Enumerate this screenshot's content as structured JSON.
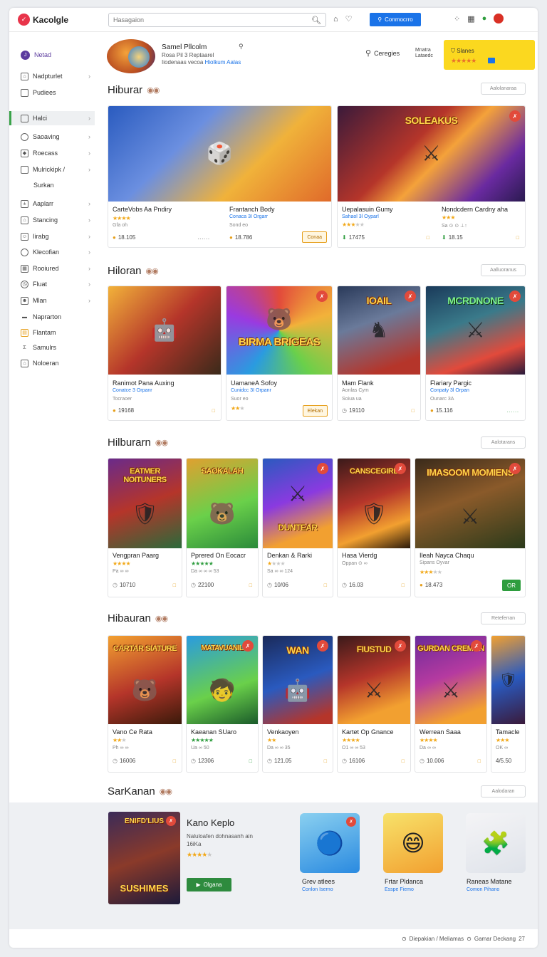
{
  "header": {
    "logo_text": "Kacolgle",
    "search_placeholder": "Hasagaion",
    "connect_label": "Conmocrro"
  },
  "sidebar": {
    "items": [
      {
        "label": "Netad",
        "icon": "J",
        "chevron": false
      },
      {
        "label": "Nadpturlet",
        "icon": "",
        "chevron": true
      },
      {
        "label": "Pudiees",
        "icon": "",
        "chevron": false
      },
      {
        "label": "Halci",
        "icon": "",
        "chevron": true
      },
      {
        "label": "Saoaving",
        "icon": "",
        "chevron": true
      },
      {
        "label": "Roecass",
        "icon": "",
        "chevron": true
      },
      {
        "label": "Mulrickipk /",
        "icon": "",
        "chevron": true
      },
      {
        "label": "Surkan",
        "icon": "",
        "chevron": false
      },
      {
        "label": "Aaplarr",
        "icon": "",
        "chevron": true
      },
      {
        "label": "Stancing",
        "icon": "",
        "chevron": true
      },
      {
        "label": "Iirabg",
        "icon": "",
        "chevron": true
      },
      {
        "label": "Klecofian",
        "icon": "",
        "chevron": true
      },
      {
        "label": "Rooiured",
        "icon": "",
        "chevron": true
      },
      {
        "label": "Fluat",
        "icon": "",
        "chevron": true
      },
      {
        "label": "Mlan",
        "icon": "",
        "chevron": true
      },
      {
        "label": "Naprarton",
        "icon": "",
        "chevron": false
      },
      {
        "label": "Flantam",
        "icon": "",
        "chevron": false
      },
      {
        "label": "Samulrs",
        "icon": "",
        "chevron": false
      },
      {
        "label": "Noloeran",
        "icon": "",
        "chevron": false
      }
    ]
  },
  "profile": {
    "name": "Samel Pllcolm",
    "line1": "Rosa Pil 3 Reptaarel",
    "line2": "Iiodenaas vecoa",
    "line2_link": "Hiolkum Aalas",
    "categories_label": "Ceregies",
    "small_link": "Mnatra Lataedc",
    "rating_label": "Slanes",
    "rating_stars": "★★★★★"
  },
  "sections": [
    {
      "title": "Hiburar",
      "see_more": "Aalolanaraa",
      "cards": [
        {
          "art_title": "",
          "title": "CarteVobs Aa Pndiry",
          "sub": "",
          "stars": "★★★★",
          "dim": "",
          "meta": "Gfa oh",
          "count": "18.105",
          "right": "......"
        },
        {
          "title": "Frantanch Body",
          "sub": "Conaca 3I Orgarr",
          "stars": "",
          "meta": "Sond eo",
          "count": "18.786",
          "button": "Conaa"
        },
        {
          "art_title": "SOLEAKUS",
          "title": "Uepalasuin Gumy",
          "sub": "Sahaol 3l Oyparl",
          "stars": "★★★",
          "dim": "★★",
          "meta": "",
          "count": "17475",
          "right": "□"
        },
        {
          "title": "Nondcdern Cardny aha",
          "sub": "",
          "stars": "★★★",
          "dim": "",
          "meta": "Sa ⊙ ⊙ ⊥↑",
          "count": "18.15",
          "right": "□"
        }
      ]
    },
    {
      "title": "Hiloran",
      "see_more": "Aalluoranus",
      "cards": [
        {
          "title": "Ranimot Pana Auxing",
          "sub": "Conatce 3 Orpanr",
          "stars": "",
          "meta": "Tocraoer",
          "count": "19168",
          "right": "□"
        },
        {
          "art_title": "BIRMA BRIGEAS",
          "title": "UamaneA Sofoy",
          "sub": "Cunidcc 3I Orpanr",
          "stars": "★★",
          "dim": "★",
          "meta": "Suor eo",
          "count": "",
          "button": "Elekan"
        },
        {
          "art_title": "IOAIL",
          "title": "Mam Flank",
          "sub": "Aonlas Cym",
          "stars": "",
          "meta": "Soiua ua",
          "count": "19110",
          "right": "□"
        },
        {
          "art_title": "MCRDNONE",
          "title": "Flariary Pargic",
          "sub": "Conpaty 3l Orpan",
          "stars": "",
          "meta": "Ounarc 3A",
          "count": "15.116",
          "right": "......"
        }
      ]
    },
    {
      "title": "Hilburarn",
      "see_more": "Aalotarans",
      "cards": [
        {
          "art_title": "EATMER NOITUNERS",
          "title": "Vengpran Paarg",
          "sub": "",
          "stars": "★★★★",
          "dim": "",
          "meta": "Pa ∞ ∞",
          "count": "10710",
          "right": "□"
        },
        {
          "art_title": "SAOKALAH",
          "title": "Pprered On Eocacr",
          "sub": "",
          "stars": "★★★★★",
          "dim": "",
          "meta": "Da ∞ ∞ ∞ 53",
          "count": "22100",
          "right": "□",
          "green": true
        },
        {
          "art_title": "DUNTEAR",
          "title": "Denkan & Rarki",
          "sub": "",
          "stars": "★",
          "dim": "★★★",
          "meta": "Sa ∞ ∞ 124",
          "count": "10/06",
          "right": "□"
        },
        {
          "art_title": "CANSCEGIRE",
          "title": "Hasa Vierdg",
          "sub": "",
          "stars": "",
          "meta": "Oppan ⊙ ∞",
          "count": "16.03",
          "right": "□"
        },
        {
          "art_title": "IMASOOM MOMIENS",
          "title": "Ileah Nayca Chaqu",
          "sub": "",
          "stars": "★★★",
          "dim": "★★",
          "meta": "Sipans Oyvar",
          "count": "18.473",
          "button": "OR"
        }
      ]
    },
    {
      "title": "Hibauran",
      "see_more": "Reteferran",
      "cards": [
        {
          "art_title": "CARTAR SIATURE",
          "title": "Vano Ce Rata",
          "sub": "",
          "stars": "★★",
          "dim": "★",
          "meta": "Ph ∞ ∞",
          "count": "16006",
          "right": "□"
        },
        {
          "art_title": "MATAVUANIL",
          "title": "Kaeanan SUaro",
          "sub": "",
          "stars": "★★★★★",
          "dim": "",
          "meta": "Ua ∞ 50",
          "count": "12306",
          "right": "□",
          "green": true
        },
        {
          "art_title": "WAN",
          "title": "Venkaoyen",
          "sub": "",
          "stars": "★★",
          "dim": "",
          "meta": "Da ∞ ∞ 35",
          "count": "121.05",
          "right": "□"
        },
        {
          "art_title": "FIUSTUD",
          "title": "Kartet Op Gnance",
          "sub": "",
          "stars": "★★★★",
          "dim": "",
          "meta": "O1 ∞ ∞ 53",
          "count": "16106",
          "right": "□"
        },
        {
          "art_title": "GURDAN CREMON",
          "title": "Werrean Saaa",
          "sub": "",
          "stars": "★★★★",
          "dim": "",
          "meta": "Da ∞ ∞",
          "count": "10.006",
          "right": "□"
        },
        {
          "art_title": "",
          "title": "Tamacle",
          "sub": "",
          "stars": "★★★",
          "dim": "",
          "meta": "OK ∞",
          "count": "4/5.50",
          "right": ""
        }
      ]
    }
  ],
  "bottom": {
    "title": "SarKanan",
    "see_more": "Aalodaran",
    "featured": {
      "art_title": "ENIFD'LIUS",
      "art_bottom": "SUSHIMES",
      "title": "Kano Keplo",
      "desc": "Naluloafen dohnasanh ain 16iKa",
      "stars": "★★★★",
      "dim": "★",
      "button": "Olgana"
    },
    "minis": [
      {
        "title": "Grev atlees",
        "sub": "Conlon Iserno"
      },
      {
        "title": "Frtar Pldanca",
        "sub": "Esspe Fiemo"
      },
      {
        "title": "Raneas Matane",
        "sub": "Comon Pihano"
      }
    ]
  },
  "footer": {
    "text": "Diepakian / Meliamas",
    "text2": "Gamar Deckang",
    "page": "27"
  }
}
